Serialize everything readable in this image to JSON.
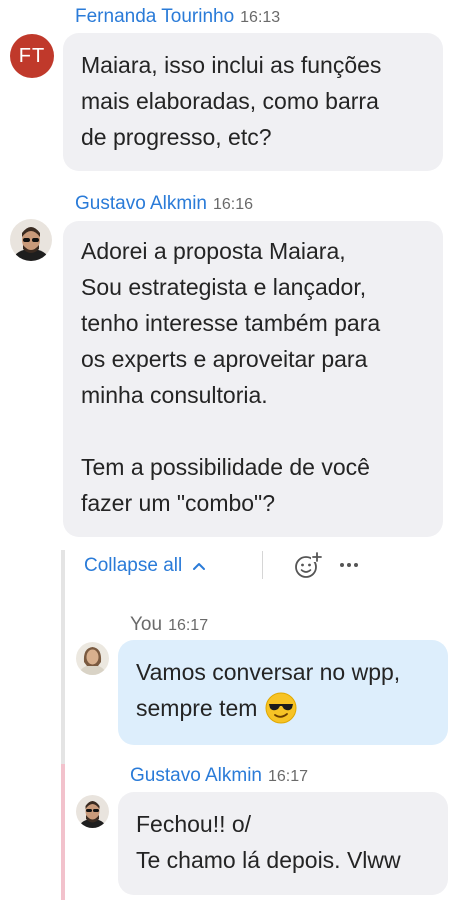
{
  "messages": [
    {
      "author": "Fernanda Tourinho",
      "time": "16:13",
      "avatar_initials": "FT",
      "lines": [
        "Maiara, isso inclui as funções",
        "mais elaboradas, como barra",
        "de progresso, etc?"
      ]
    },
    {
      "author": "Gustavo Alkmin",
      "time": "16:16",
      "lines": [
        "Adorei a proposta Maiara,",
        "Sou estrategista e lançador,",
        "tenho interesse também para",
        "os experts e aproveitar para",
        "minha consultoria.",
        "",
        "Tem a possibilidade de você",
        "fazer um \"combo\"?"
      ]
    }
  ],
  "thread": {
    "collapse_label": "Collapse all",
    "icons": {
      "collapse": "chevron-up-icon",
      "react": "add-reaction-icon",
      "more": "more-options-icon"
    },
    "replies": [
      {
        "author": "You",
        "time": "16:17",
        "lines": [
          "Vamos conversar no wpp,",
          "sempre tem"
        ],
        "emoji": "😎"
      },
      {
        "author": "Gustavo Alkmin",
        "time": "16:17",
        "lines": [
          "Fechou!! o/",
          "Te chamo lá depois. Vlww"
        ]
      }
    ]
  },
  "colors": {
    "name": "#2a7bd8",
    "bubble": "#f0f0f3",
    "my_bubble": "#ddeefc",
    "ft_avatar": "#c0392b",
    "thread_line_gray": "#e4e4e4",
    "thread_line_pink": "#f2c2cc"
  }
}
